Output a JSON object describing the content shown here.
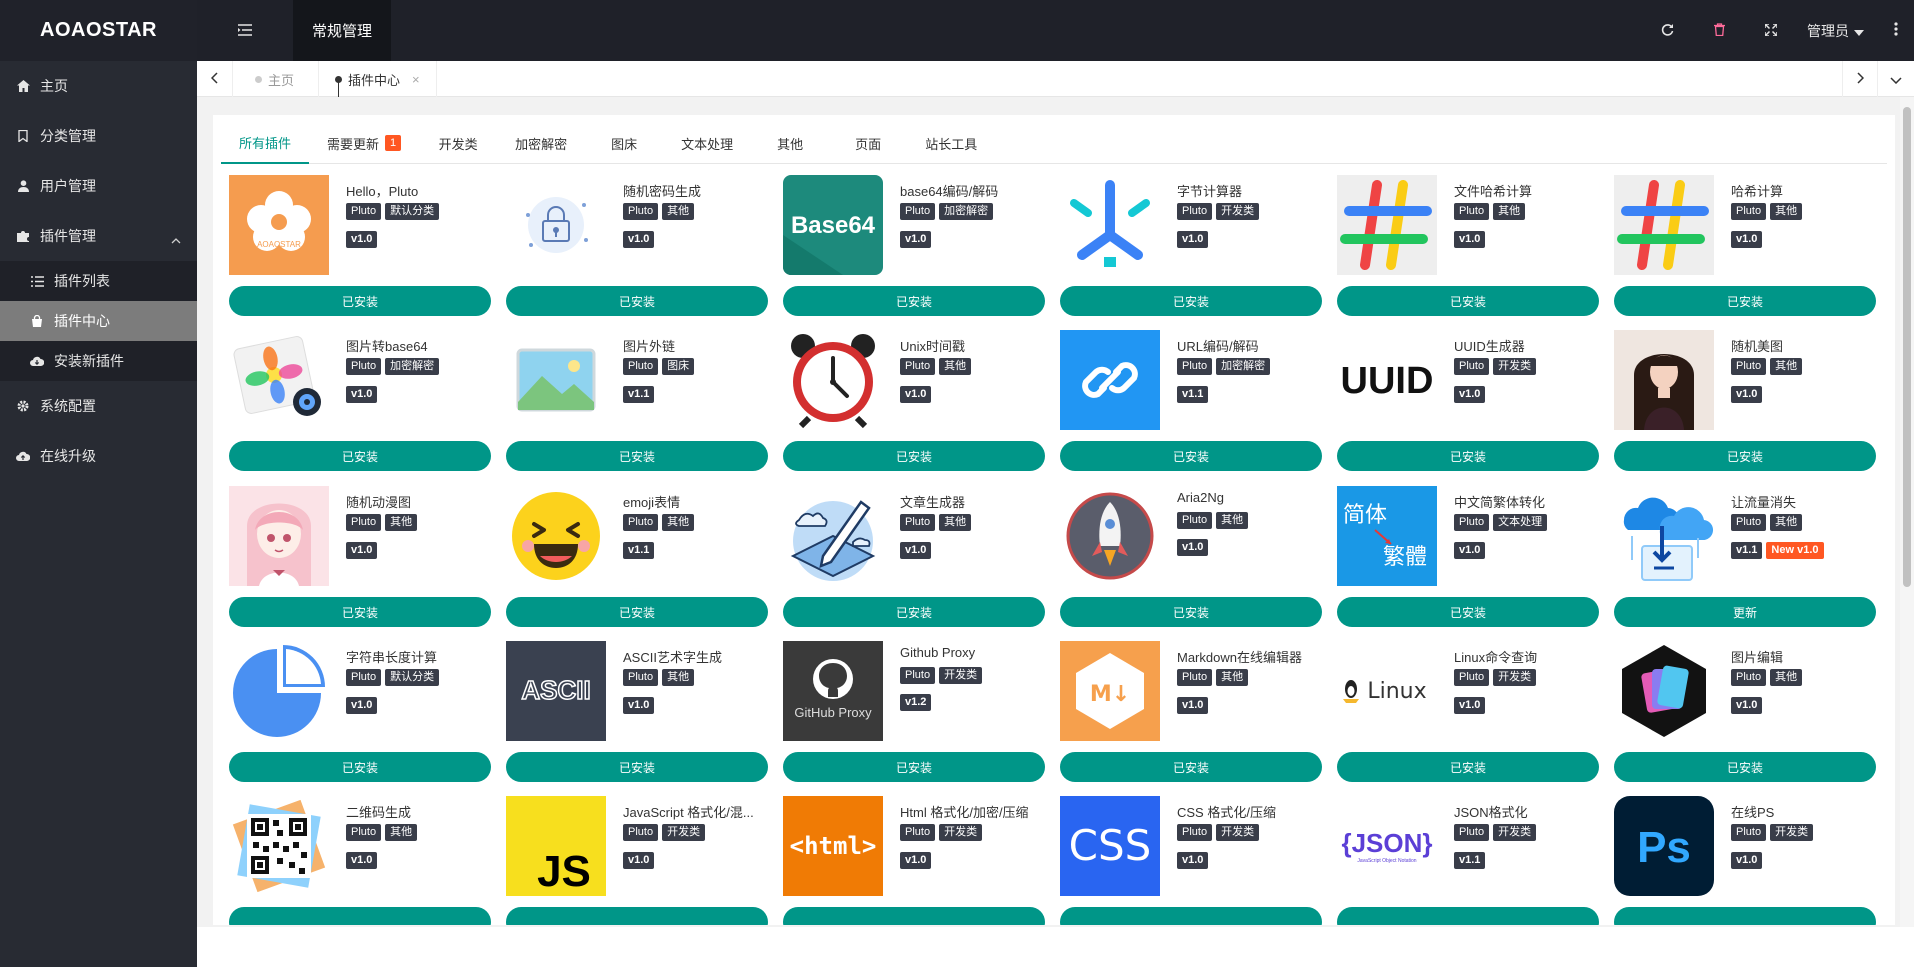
{
  "app": {
    "logo": "AOAOSTAR",
    "module": "常规管理",
    "user": "管理员"
  },
  "sidebar": {
    "items": [
      {
        "label": "主页",
        "icon": "home-icon"
      },
      {
        "label": "分类管理",
        "icon": "bookmark-icon"
      },
      {
        "label": "用户管理",
        "icon": "user-icon"
      },
      {
        "label": "插件管理",
        "icon": "puzzle-icon"
      }
    ],
    "sub": [
      {
        "label": "插件列表",
        "icon": "list-icon"
      },
      {
        "label": "插件中心",
        "icon": "bag-icon"
      },
      {
        "label": "安装新插件",
        "icon": "cloud-download-icon"
      }
    ],
    "bottom": [
      {
        "label": "系统配置",
        "icon": "gear-icon"
      },
      {
        "label": "在线升级",
        "icon": "cloud-upload-icon"
      }
    ]
  },
  "pagetabs": {
    "home": "主页",
    "current": "插件中心",
    "close": "×"
  },
  "filters": {
    "items": [
      "所有插件",
      "需要更新",
      "开发类",
      "加密解密",
      "图床",
      "文本处理",
      "其他",
      "页面",
      "站长工具"
    ],
    "update_count": "1"
  },
  "plugins": [
    {
      "name": "Hello，Pluto",
      "tags": [
        "Pluto",
        "默认分类"
      ],
      "ver": "v1.0",
      "btn": "已安装"
    },
    {
      "name": "随机密码生成",
      "tags": [
        "Pluto",
        "其他"
      ],
      "ver": "v1.0",
      "btn": "已安装"
    },
    {
      "name": "base64编码/解码",
      "tags": [
        "Pluto",
        "加密解密"
      ],
      "ver": "v1.0",
      "btn": "已安装"
    },
    {
      "name": "字节计算器",
      "tags": [
        "Pluto",
        "开发类"
      ],
      "ver": "v1.0",
      "btn": "已安装"
    },
    {
      "name": "文件哈希计算",
      "tags": [
        "Pluto",
        "其他"
      ],
      "ver": "v1.0",
      "btn": "已安装"
    },
    {
      "name": "哈希计算",
      "tags": [
        "Pluto",
        "其他"
      ],
      "ver": "v1.0",
      "btn": "已安装"
    },
    {
      "name": "图片转base64",
      "tags": [
        "Pluto",
        "加密解密"
      ],
      "ver": "v1.0",
      "btn": "已安装"
    },
    {
      "name": "图片外链",
      "tags": [
        "Pluto",
        "图床"
      ],
      "ver": "v1.1",
      "btn": "已安装"
    },
    {
      "name": "Unix时间戳",
      "tags": [
        "Pluto",
        "其他"
      ],
      "ver": "v1.0",
      "btn": "已安装"
    },
    {
      "name": "URL编码/解码",
      "tags": [
        "Pluto",
        "加密解密"
      ],
      "ver": "v1.1",
      "btn": "已安装"
    },
    {
      "name": "UUID生成器",
      "tags": [
        "Pluto",
        "开发类"
      ],
      "ver": "v1.0",
      "btn": "已安装"
    },
    {
      "name": "随机美图",
      "tags": [
        "Pluto",
        "其他"
      ],
      "ver": "v1.0",
      "btn": "已安装"
    },
    {
      "name": "随机动漫图",
      "tags": [
        "Pluto",
        "其他"
      ],
      "ver": "v1.0",
      "btn": "已安装"
    },
    {
      "name": "emoji表情",
      "tags": [
        "Pluto",
        "其他"
      ],
      "ver": "v1.1",
      "btn": "已安装"
    },
    {
      "name": "文章生成器",
      "tags": [
        "Pluto",
        "其他"
      ],
      "ver": "v1.0",
      "btn": "已安装"
    },
    {
      "name": "Aria2Ng",
      "tags": [
        "Pluto",
        "其他"
      ],
      "ver": "v1.0",
      "btn": "已安装"
    },
    {
      "name": "中文简繁体转化",
      "tags": [
        "Pluto",
        "文本处理"
      ],
      "ver": "v1.0",
      "btn": "已安装"
    },
    {
      "name": "让流量消失",
      "tags": [
        "Pluto",
        "其他"
      ],
      "ver": "v1.1",
      "newver": "New v1.0",
      "btn": "更新"
    },
    {
      "name": "字符串长度计算",
      "tags": [
        "Pluto",
        "默认分类"
      ],
      "ver": "v1.0",
      "btn": "已安装"
    },
    {
      "name": "ASCII艺术字生成",
      "tags": [
        "Pluto",
        "其他"
      ],
      "ver": "v1.0",
      "btn": "已安装"
    },
    {
      "name": "Github Proxy",
      "tags": [
        "Pluto",
        "开发类"
      ],
      "ver": "v1.2",
      "btn": "已安装"
    },
    {
      "name": "Markdown在线编辑器",
      "tags": [
        "Pluto",
        "其他"
      ],
      "ver": "v1.0",
      "btn": "已安装"
    },
    {
      "name": "Linux命令查询",
      "tags": [
        "Pluto",
        "开发类"
      ],
      "ver": "v1.0",
      "btn": "已安装"
    },
    {
      "name": "图片编辑",
      "tags": [
        "Pluto",
        "其他"
      ],
      "ver": "v1.0",
      "btn": "已安装"
    },
    {
      "name": "二维码生成",
      "tags": [
        "Pluto",
        "其他"
      ],
      "ver": "v1.0",
      "btn": ""
    },
    {
      "name": "JavaScript 格式化/混...",
      "tags": [
        "Pluto",
        "开发类"
      ],
      "ver": "v1.0",
      "btn": ""
    },
    {
      "name": "Html 格式化/加密/压缩",
      "tags": [
        "Pluto",
        "开发类"
      ],
      "ver": "v1.0",
      "btn": ""
    },
    {
      "name": "CSS 格式化/压缩",
      "tags": [
        "Pluto",
        "开发类"
      ],
      "ver": "v1.0",
      "btn": ""
    },
    {
      "name": "JSON格式化",
      "tags": [
        "Pluto",
        "开发类"
      ],
      "ver": "v1.1",
      "btn": ""
    },
    {
      "name": "在线PS",
      "tags": [
        "Pluto",
        "开发类"
      ],
      "ver": "v1.0",
      "btn": ""
    }
  ],
  "thumb_text": {
    "base64": "Base64",
    "uuid": "UUID",
    "ascii": "ASCII",
    "github": "GitHub Proxy",
    "md": "M↓",
    "linux": "Linux",
    "js": "JS",
    "html": "<html>",
    "css": "CSS",
    "json": "{JSON}",
    "json_sub": "JavaScript Object Notation",
    "ps": "Ps",
    "hanzi1": "简体",
    "hanzi2": "繁體",
    "logo_small": "AOAOSTAR"
  }
}
